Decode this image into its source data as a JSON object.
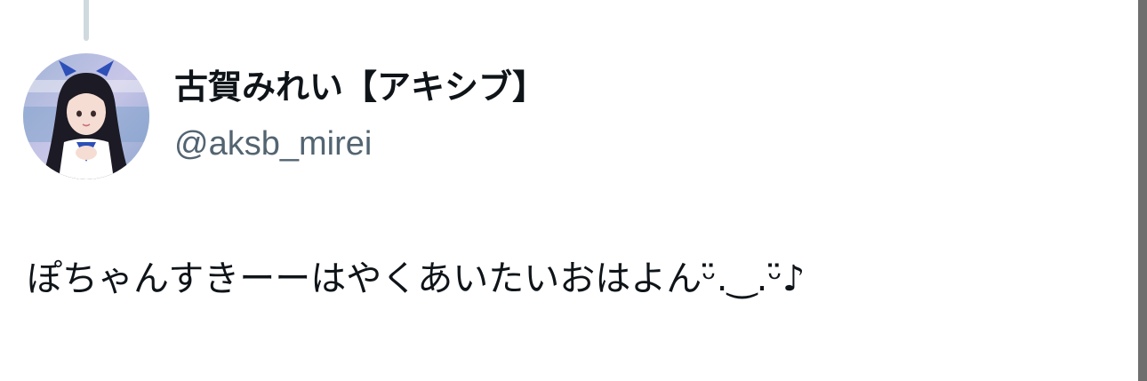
{
  "author": {
    "display_name": "古賀みれい【アキシブ】",
    "handle": "@aksb_mirei"
  },
  "tweet": {
    "text": "ぽちゃんすきーーはやくあいたいおはよんᵕ̈.‿.ᵕ̈♪"
  },
  "colors": {
    "text_primary": "#0f1419",
    "text_secondary": "#536471",
    "thread_line": "#cfd9de",
    "background": "#ffffff"
  }
}
